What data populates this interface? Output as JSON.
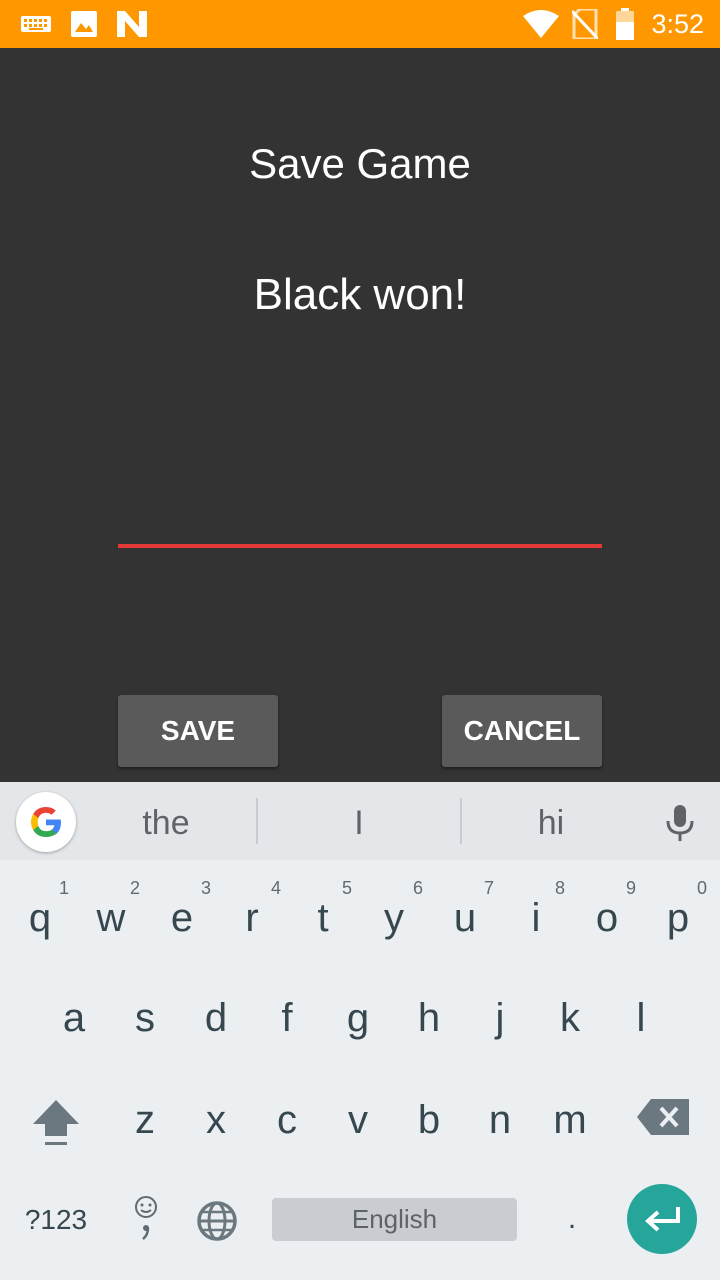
{
  "status_bar": {
    "time": "3:52",
    "left_icons": [
      "keyboard-icon",
      "image-icon",
      "n-logo-icon"
    ],
    "right_icons": [
      "wifi-icon",
      "no-sim-icon",
      "battery-icon"
    ],
    "background": "#FF9800"
  },
  "dialog": {
    "title": "Save Game",
    "message": "Black won!",
    "input_value": "",
    "save_label": "SAVE",
    "cancel_label": "CANCEL",
    "input_underline_color": "#E53935"
  },
  "keyboard": {
    "suggestions": [
      "the",
      "I",
      "hi"
    ],
    "row1": [
      {
        "ch": "q",
        "num": "1"
      },
      {
        "ch": "w",
        "num": "2"
      },
      {
        "ch": "e",
        "num": "3"
      },
      {
        "ch": "r",
        "num": "4"
      },
      {
        "ch": "t",
        "num": "5"
      },
      {
        "ch": "y",
        "num": "6"
      },
      {
        "ch": "u",
        "num": "7"
      },
      {
        "ch": "i",
        "num": "8"
      },
      {
        "ch": "o",
        "num": "9"
      },
      {
        "ch": "p",
        "num": "0"
      }
    ],
    "row2": [
      "a",
      "s",
      "d",
      "f",
      "g",
      "h",
      "j",
      "k",
      "l"
    ],
    "row3": [
      "z",
      "x",
      "c",
      "v",
      "b",
      "n",
      "m"
    ],
    "symbols_label": "?123",
    "space_label": "English",
    "period_label": ".",
    "accent_color": "#26A69A"
  }
}
